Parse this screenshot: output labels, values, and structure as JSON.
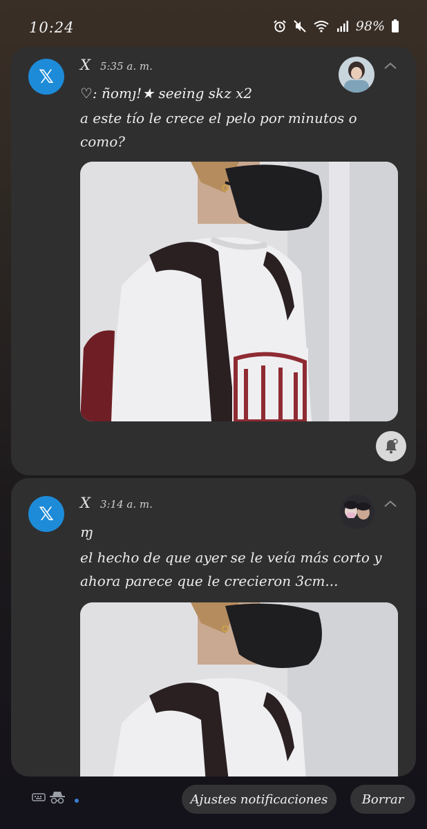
{
  "status_bar": {
    "time": "10:24",
    "battery": "98%",
    "icons": [
      "alarm-icon",
      "mute-icon",
      "wifi-icon",
      "signal-icon",
      "battery-icon"
    ]
  },
  "notifications": [
    {
      "app_icon": "x-logo-icon",
      "app_name": "X",
      "timestamp": "5:35 a. m.",
      "title": "♡: ñomȷ!★ seeing skz x2",
      "body": "a este tío le crece el pelo por minutos o como?",
      "image": "photo of person with black face mask, grey sweatshirt and backpack"
    },
    {
      "app_icon": "x-logo-icon",
      "app_name": "X",
      "timestamp": "3:14 a. m.",
      "title": "ɱ",
      "body": "el hecho de que ayer se le veía más corto y ahora parece que le crecieron 3cm...",
      "image": "photo of person with black face mask, grey sweatshirt and backpack"
    }
  ],
  "footer": {
    "settings_label": "Ajustes notificaciones",
    "clear_label": "Borrar"
  },
  "colors": {
    "card_bg": "#2f2f30",
    "x_icon_bg": "#1d8bd8",
    "pill_bg": "#333335"
  }
}
